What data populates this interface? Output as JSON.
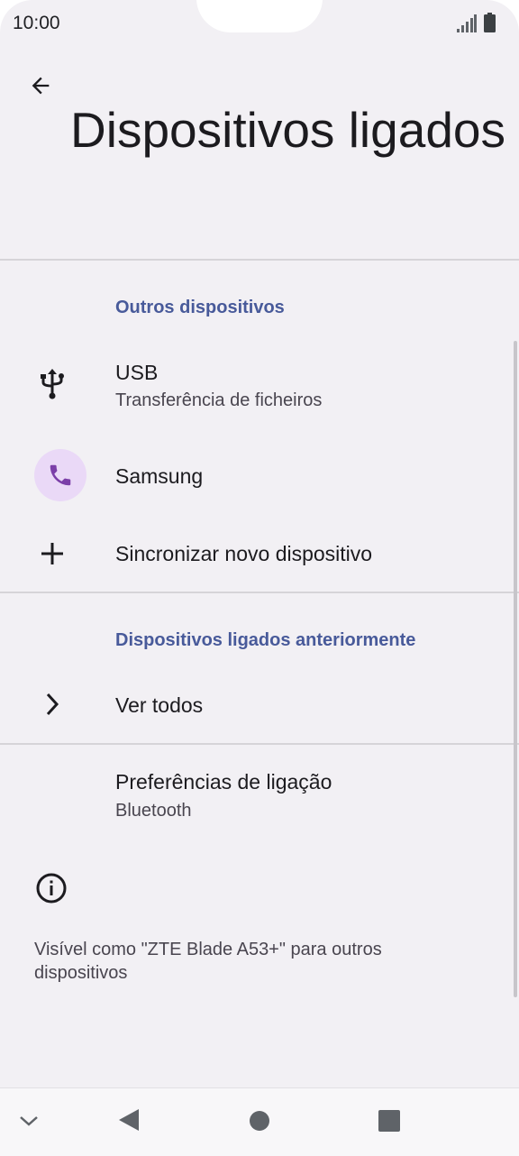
{
  "status_bar": {
    "time": "10:00",
    "signal_icon": "cellular-signal-icon",
    "battery_icon": "battery-icon"
  },
  "header": {
    "back_icon": "arrow-left-icon",
    "title": "Dispositivos ligados"
  },
  "sections": {
    "other_devices": {
      "header": "Outros dispositivos",
      "usb": {
        "title": "USB",
        "subtitle": "Transferência de ficheiros",
        "icon": "usb-icon"
      },
      "samsung": {
        "title": "Samsung",
        "icon": "phone-icon"
      },
      "pair_new": {
        "title": "Sincronizar novo dispositivo",
        "icon": "plus-icon"
      }
    },
    "previous_devices": {
      "header": "Dispositivos ligados anteriormente",
      "see_all": {
        "title": "Ver todos",
        "icon": "chevron-right-icon"
      }
    },
    "connection_prefs": {
      "title": "Preferências de ligação",
      "subtitle": "Bluetooth"
    },
    "info": {
      "icon": "info-icon",
      "text": "Visível como \"ZTE Blade A53+\" para outros dispositivos"
    }
  },
  "colors": {
    "accent": "#485a9a",
    "phone_circle": "#ead9f7",
    "phone_icon": "#7b3fa8",
    "background": "#f2f0f4"
  },
  "nav_bar": {
    "hide_icon": "chevron-down-icon",
    "back_icon": "triangle-back-icon",
    "home_icon": "circle-home-icon",
    "recents_icon": "square-recents-icon"
  }
}
